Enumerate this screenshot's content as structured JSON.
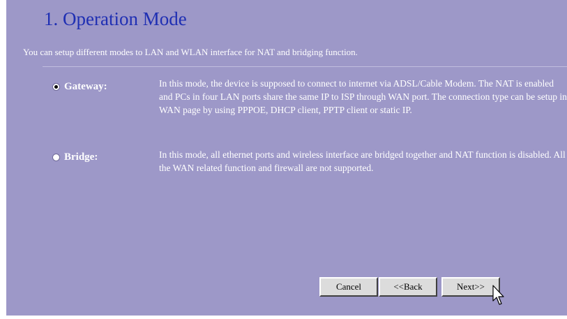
{
  "page": {
    "title": "1. Operation Mode",
    "intro": "You can setup different modes to LAN and WLAN interface for NAT and bridging function."
  },
  "modes": [
    {
      "label": "Gateway:",
      "checked": true,
      "description": "In this mode, the device is supposed to connect to internet via ADSL/Cable Modem. The NAT is enabled and PCs in four LAN ports share the same IP to ISP through WAN port. The connection type can be setup in WAN page by using PPPOE, DHCP client, PPTP client or static IP."
    },
    {
      "label": "Bridge:",
      "checked": false,
      "description": "In this mode, all ethernet ports and wireless interface are bridged together and NAT function is disabled. All the WAN related function and firewall are not supported."
    }
  ],
  "buttons": {
    "cancel": "Cancel",
    "back": "<<Back",
    "next": "Next>>"
  },
  "colors": {
    "background": "#9d98c8",
    "title": "#1f2fb3",
    "text": "#ffffff",
    "button": "#dcdcdc"
  }
}
